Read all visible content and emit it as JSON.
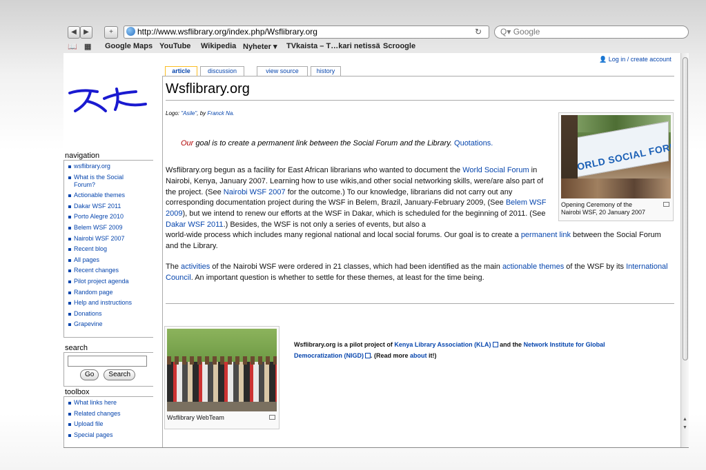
{
  "browser": {
    "url": "http://www.wsflibrary.org/index.php/Wsflibrary.org",
    "url_reload_icon": "reload-icon",
    "search_placeholder": "Q▾ Google",
    "back_glyph": "◀",
    "forward_glyph": "▶",
    "add_glyph": "+",
    "bookmarks": [
      "Google Maps",
      "YouTube",
      "Wikipedia",
      "Nyheter ▾",
      "TVkaista – T…kari netissä",
      "Scroogle"
    ]
  },
  "wiki": {
    "login_label": "Log in / create account",
    "tabs": [
      "article",
      "discussion",
      "view source",
      "history"
    ],
    "title": "Wsflibrary.org",
    "logo_credit_prefix": "Logo: ",
    "logo_credit_name": "\"Asile\"",
    "logo_credit_mid": ", by ",
    "logo_credit_author": "Franck Na.",
    "goal_our": "Our",
    "goal_text": " goal is to create a permanent link between the Social Forum and the Library. ",
    "goal_link": "Quotations.",
    "p1": {
      "a": "Wsflibrary.org begun as a facility for East African librarians who wanted to document the ",
      "l1": "World Social Forum",
      "b": " in Nairobi, Kenya, January 2007. Learning how to use wikis,and other social networking skills, were/are also part of the project. (See ",
      "l2": "Nairobi WSF 2007",
      "c": " for the outcome.) To our knowledge, librarians did not carry out any corresponding documentation project during the WSF in Belem, Brazil, January-February 2009, (See ",
      "l3": "Belem WSF 2009",
      "d": "), but we intend to renew our efforts at the WSF in Dakar, which is scheduled for the beginning of 2011. (See ",
      "l4": "Dakar WSF 2011",
      "e": ".) Besides, the WSF is not only a series of events, but also a"
    },
    "p2": {
      "a": "world-wide process which includes many regional national and local social forums. Our goal is to create a ",
      "l1": "permanent link",
      "b": " between the Social Forum and the Library."
    },
    "p3": {
      "a": "The ",
      "l1": "activities",
      "b": " of the Nairobi WSF were ordered in 21 classes, which had been identified as the main ",
      "l2": "actionable themes",
      "c": " of the WSF by its ",
      "l3": "International Council",
      "d": ". An important question is whether to settle for these themes, at least for the time being."
    },
    "thumb1_caption": "Opening Ceremony of the Nairobi WSF, 20 January 2007",
    "thumb1_sign": "WORLD SOCIAL FORUM",
    "thumb2_caption": "Wsflibrary WebTeam",
    "pilot": {
      "a": "Wsflibrary.org is a pilot project of ",
      "l1": "Kenya Library Association (KLA)",
      "b": " and the ",
      "l2": "Network Institute for Global Democratization (NIGD)",
      "c": ". (Read more ",
      "l3": "about",
      "d": " it!)"
    }
  },
  "sidebar": {
    "navigation_title": "navigation",
    "navigation": [
      "wsflibrary.org",
      "What is the Social Forum?",
      "Actionable themes",
      "Dakar WSF 2011",
      "Porto Alegre 2010",
      "Belem WSF 2009",
      "Nairobi WSF 2007",
      "Recent blog",
      "All pages",
      "Recent changes",
      "Pilot project agenda",
      "Random page",
      "Help and instructions",
      "Donations",
      "Grapevine"
    ],
    "search_title": "search",
    "go_label": "Go",
    "search_label": "Search",
    "toolbox_title": "toolbox",
    "toolbox": [
      "What links here",
      "Related changes",
      "Upload file",
      "Special pages"
    ]
  },
  "colors": {
    "link": "#0645ad",
    "goal_red": "#b00000",
    "logo_blue": "#1a1ad0"
  }
}
